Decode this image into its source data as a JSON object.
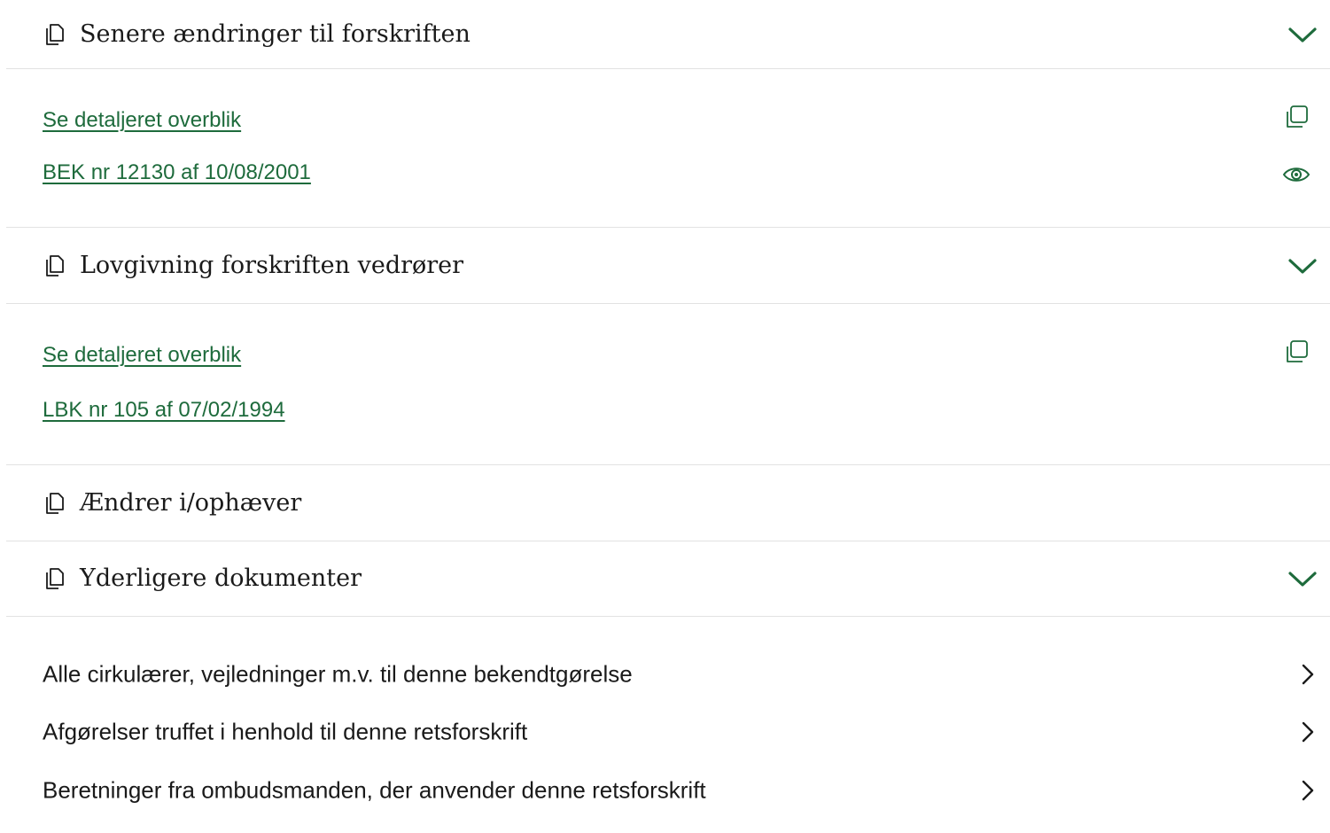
{
  "sections": {
    "later_changes": {
      "title": "Senere ændringer til forskriften",
      "links": [
        "Se detaljeret overblik",
        "BEK nr 12130 af 10/08/2001"
      ]
    },
    "legislation": {
      "title": "Lovgivning forskriften vedrører",
      "links": [
        "Se detaljeret overblik",
        "LBK nr 105 af 07/02/1994"
      ]
    },
    "amends": {
      "title": "Ændrer i/ophæver"
    },
    "further_docs": {
      "title": "Yderligere dokumenter",
      "items": [
        "Alle cirkulærer, vejledninger m.v. til denne bekendtgørelse",
        "Afgørelser truffet i henhold til denne retsforskrift",
        "Beretninger fra ombudsmanden, der anvender denne retsforskrift"
      ]
    }
  },
  "icons": {
    "section": "documents-icon",
    "expand": "chevron-down-icon",
    "copy": "copy-icon",
    "view": "eye-icon",
    "row": "chevron-right-icon"
  },
  "colors": {
    "accent": "#1e6b3c",
    "divider": "#e2e2e2",
    "text": "#1a1a1a"
  }
}
